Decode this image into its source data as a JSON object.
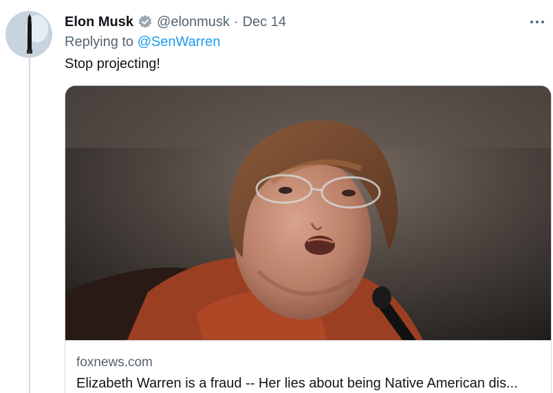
{
  "tweet": {
    "author_name": "Elon Musk",
    "verified_icon": "verified-badge-icon",
    "handle": "@elonmusk",
    "separator": "·",
    "date": "Dec 14",
    "replying_prefix": "Replying to",
    "replying_mention": "@SenWarren",
    "text": "Stop projecting!",
    "more_icon": "more-options-icon"
  },
  "card": {
    "image_icon": "article-photo",
    "domain": "foxnews.com",
    "title": "Elizabeth Warren is a fraud -- Her lies about being Native American dis..."
  },
  "colors": {
    "text_primary": "#0f1419",
    "text_secondary": "#536471",
    "accent": "#1d9bf0",
    "border": "#cfd9de"
  }
}
